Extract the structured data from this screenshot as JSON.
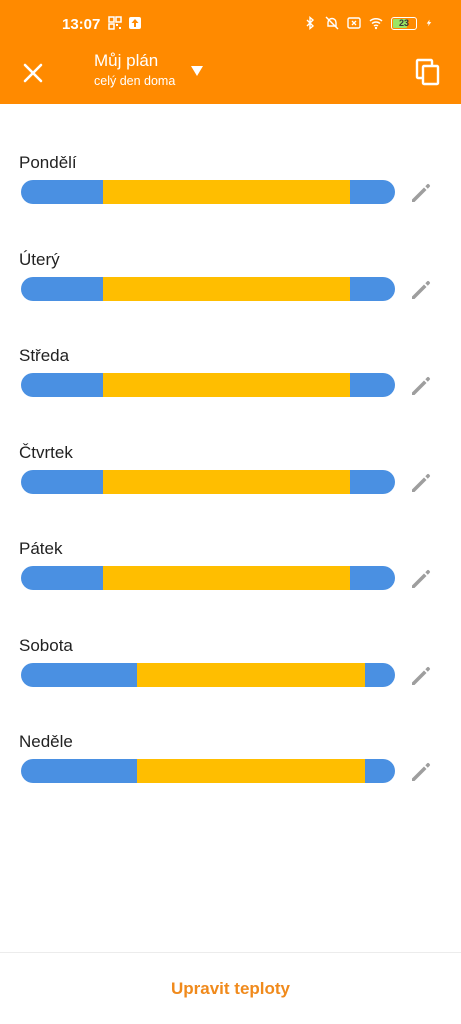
{
  "status_bar": {
    "time": "13:07",
    "battery": "23"
  },
  "header": {
    "title": "Můj plán",
    "subtitle": "celý den doma",
    "icons": {
      "close": "close-icon",
      "dropdown": "dropdown-arrow-icon",
      "copy": "copy-icon"
    }
  },
  "colors": {
    "accent": "#ff8a00",
    "blue": "#4a90e2",
    "yellow": "#ffbe00",
    "action_text": "#f08a1c"
  },
  "days": [
    {
      "label": "Pondělí",
      "segments": [
        {
          "color": "blue",
          "fraction": 0.22
        },
        {
          "color": "yellow",
          "fraction": 0.66
        },
        {
          "color": "blue",
          "fraction": 0.12
        }
      ]
    },
    {
      "label": "Úterý",
      "segments": [
        {
          "color": "blue",
          "fraction": 0.22
        },
        {
          "color": "yellow",
          "fraction": 0.66
        },
        {
          "color": "blue",
          "fraction": 0.12
        }
      ]
    },
    {
      "label": "Středa",
      "segments": [
        {
          "color": "blue",
          "fraction": 0.22
        },
        {
          "color": "yellow",
          "fraction": 0.66
        },
        {
          "color": "blue",
          "fraction": 0.12
        }
      ]
    },
    {
      "label": "Čtvrtek",
      "segments": [
        {
          "color": "blue",
          "fraction": 0.22
        },
        {
          "color": "yellow",
          "fraction": 0.66
        },
        {
          "color": "blue",
          "fraction": 0.12
        }
      ]
    },
    {
      "label": "Pátek",
      "segments": [
        {
          "color": "blue",
          "fraction": 0.22
        },
        {
          "color": "yellow",
          "fraction": 0.66
        },
        {
          "color": "blue",
          "fraction": 0.12
        }
      ]
    },
    {
      "label": "Sobota",
      "segments": [
        {
          "color": "blue",
          "fraction": 0.31
        },
        {
          "color": "yellow",
          "fraction": 0.61
        },
        {
          "color": "blue",
          "fraction": 0.08
        }
      ]
    },
    {
      "label": "Neděle",
      "segments": [
        {
          "color": "blue",
          "fraction": 0.31
        },
        {
          "color": "yellow",
          "fraction": 0.61
        },
        {
          "color": "blue",
          "fraction": 0.08
        }
      ]
    }
  ],
  "bottom": {
    "action_label": "Upravit teploty"
  }
}
